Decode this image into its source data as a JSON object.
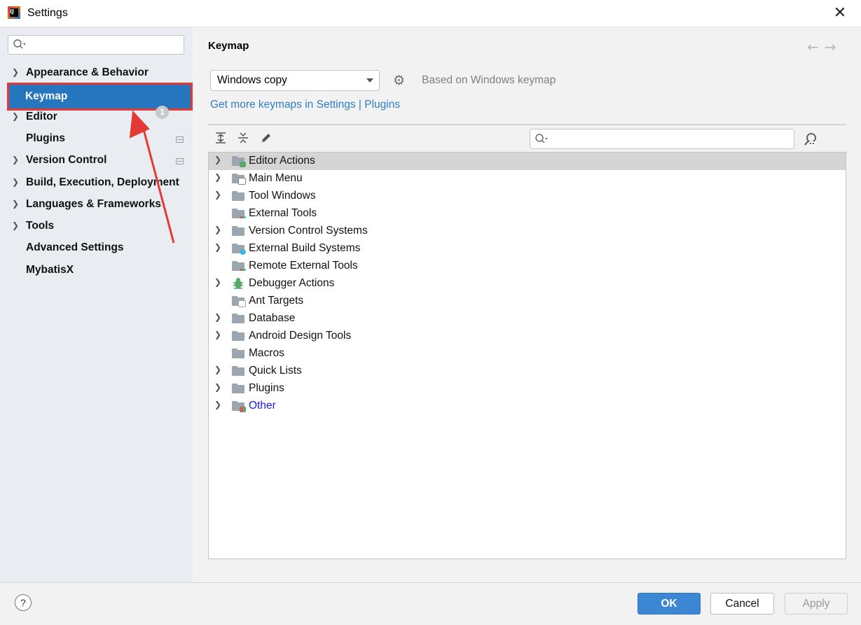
{
  "window": {
    "title": "Settings"
  },
  "sidebar": {
    "search_placeholder": "",
    "items": [
      {
        "label": "Appearance & Behavior",
        "expandable": true
      },
      {
        "label": "Keymap",
        "expandable": false,
        "selected": true
      },
      {
        "label": "Editor",
        "expandable": true
      },
      {
        "label": "Plugins",
        "expandable": false,
        "badge": "1"
      },
      {
        "label": "Version Control",
        "expandable": true
      },
      {
        "label": "Build, Execution, Deployment",
        "expandable": true
      },
      {
        "label": "Languages & Frameworks",
        "expandable": true
      },
      {
        "label": "Tools",
        "expandable": true
      },
      {
        "label": "Advanced Settings",
        "expandable": false
      },
      {
        "label": "MybatisX",
        "expandable": false
      }
    ]
  },
  "main": {
    "title": "Keymap",
    "keymap_select": {
      "value": "Windows copy"
    },
    "based_on": "Based on Windows keymap",
    "more_link": "Get more keymaps in Settings | Plugins",
    "tree_search_placeholder": "",
    "tree": [
      {
        "label": "Editor Actions",
        "expandable": true,
        "selected": true,
        "icon": "editor-actions-folder-icon"
      },
      {
        "label": "Main Menu",
        "expandable": true,
        "icon": "main-menu-folder-icon"
      },
      {
        "label": "Tool Windows",
        "expandable": true,
        "icon": "folder-icon"
      },
      {
        "label": "External Tools",
        "expandable": false,
        "icon": "external-tools-folder-icon"
      },
      {
        "label": "Version Control Systems",
        "expandable": true,
        "icon": "folder-icon"
      },
      {
        "label": "External Build Systems",
        "expandable": true,
        "icon": "external-build-folder-icon"
      },
      {
        "label": "Remote External Tools",
        "expandable": false,
        "icon": "remote-tools-folder-icon"
      },
      {
        "label": "Debugger Actions",
        "expandable": true,
        "icon": "bug-icon"
      },
      {
        "label": "Ant Targets",
        "expandable": false,
        "icon": "ant-folder-icon"
      },
      {
        "label": "Database",
        "expandable": true,
        "icon": "folder-icon"
      },
      {
        "label": "Android Design Tools",
        "expandable": true,
        "icon": "folder-icon"
      },
      {
        "label": "Macros",
        "expandable": false,
        "icon": "folder-icon"
      },
      {
        "label": "Quick Lists",
        "expandable": true,
        "icon": "folder-icon"
      },
      {
        "label": "Plugins",
        "expandable": true,
        "icon": "folder-icon"
      },
      {
        "label": "Other",
        "expandable": true,
        "icon": "other-folder-icon",
        "link_color": "#1a1af0"
      }
    ]
  },
  "footer": {
    "ok_label": "OK",
    "cancel_label": "Cancel",
    "apply_label": "Apply",
    "help_label": "?"
  },
  "colors": {
    "selection": "#2675bf",
    "highlight_box": "#e53935",
    "link": "#2f7ec8",
    "ok_button": "#3b87d4"
  }
}
